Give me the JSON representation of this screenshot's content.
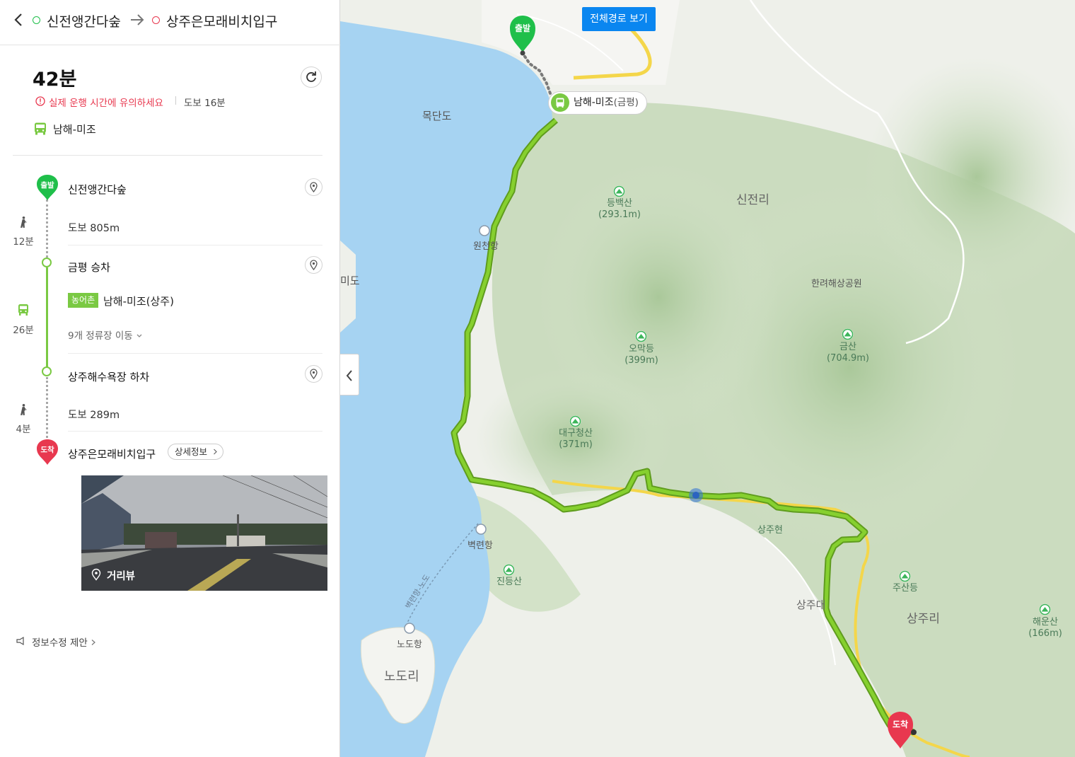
{
  "header": {
    "origin": "신전앵간다숲",
    "destination": "상주은모래비치입구"
  },
  "summary": {
    "total_time": "42분",
    "warning": "실제 운행 시간에 유의하세요",
    "walk_total": "도보 16분",
    "route_name": "남해-미조"
  },
  "steps": {
    "start": {
      "marker": "출발",
      "title": "신전앵간다숲"
    },
    "walk1": {
      "distance": "도보 805m",
      "time": "12분"
    },
    "board": {
      "title": "금평 승차",
      "bus_type": "농어촌",
      "bus_route": "남해-미조(상주)",
      "stops": "9개 정류장 이동",
      "time": "26분"
    },
    "alight": {
      "title": "상주해수욕장 하차"
    },
    "walk2": {
      "distance": "도보 289m",
      "time": "4분"
    },
    "end": {
      "marker": "도착",
      "title": "상주은모래비치입구",
      "detail_button": "상세정보"
    }
  },
  "panorama": {
    "label": "거리뷰"
  },
  "footer": {
    "suggest": "정보수정 제안"
  },
  "map": {
    "full_route_button": "전체경로 보기",
    "bus_stop_callout": {
      "name": "남해-미조",
      "detail": "(금평)"
    },
    "start_marker": "출발",
    "end_marker": "도착",
    "mountains": [
      {
        "name": "등백산",
        "height": "(293.1m)"
      },
      {
        "name": "오막등",
        "height": "(399m)"
      },
      {
        "name": "금산",
        "height": "(704.9m)"
      },
      {
        "name": "대구청산",
        "height": "(371m)"
      },
      {
        "name": "진등산",
        "height": ""
      },
      {
        "name": "주산등",
        "height": ""
      },
      {
        "name": "해운산",
        "height": "(166m)"
      }
    ],
    "places": {
      "mokdando": "목단도",
      "sinjeonri": "신전리",
      "hallyeo": "한려해상공원",
      "sangjuhyeon": "상주현",
      "sangjuri": "상주리",
      "sangju_partial": "상주대",
      "byeokryeon": "벽련항",
      "nodo": "노도항",
      "nodori": "노도리",
      "wonchen": "원천항",
      "ferry": "벽련항-노도",
      "partial_left": "미도"
    },
    "colors": {
      "route": "#7ac943",
      "sea": "#a6d3f2",
      "land_green": "#c9dcbc",
      "start": "#1fbf4a",
      "end": "#e8384f"
    }
  }
}
